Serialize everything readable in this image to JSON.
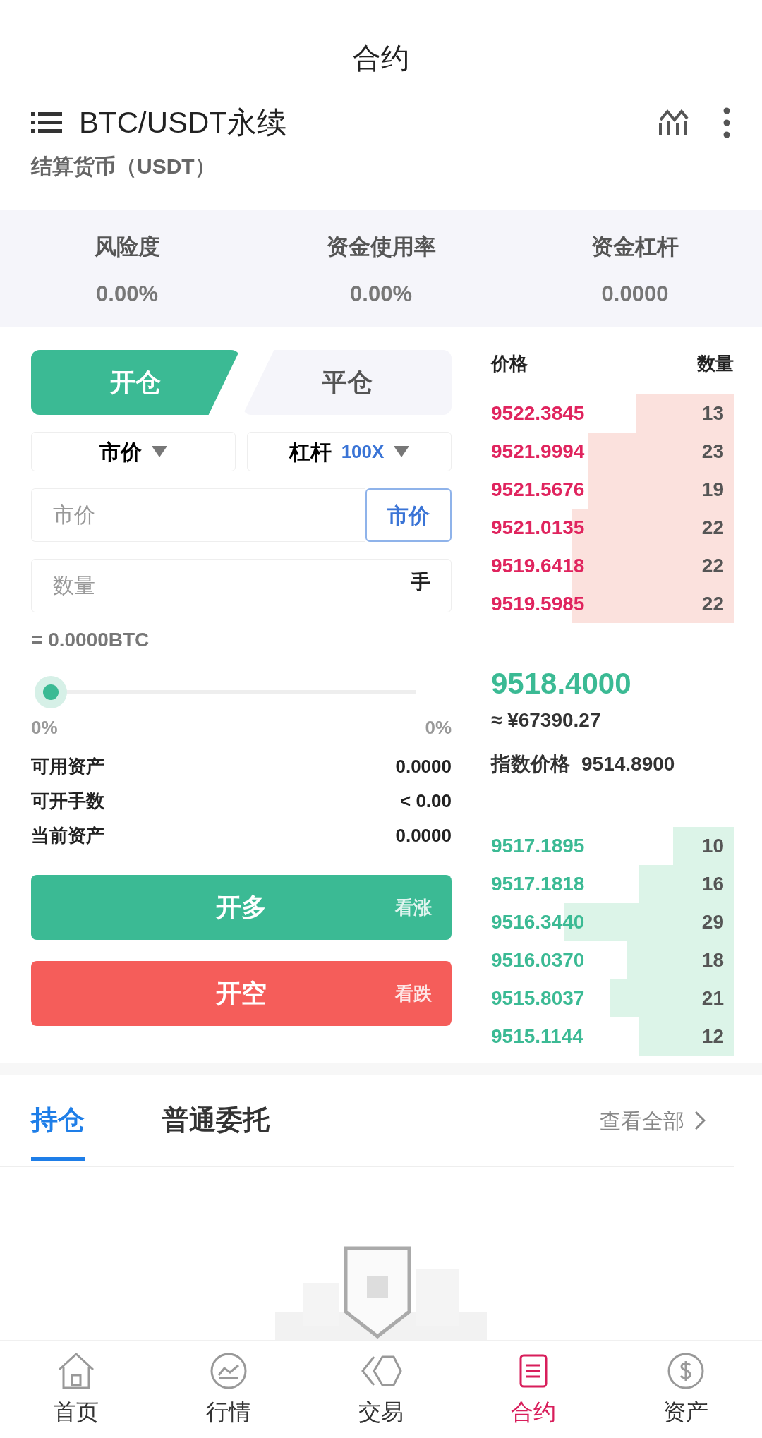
{
  "title": "合约",
  "pair": {
    "name": "BTC/USDT永续",
    "settlement": "结算货币（USDT）"
  },
  "stats": [
    {
      "label": "风险度",
      "value": "0.00%"
    },
    {
      "label": "资金使用率",
      "value": "0.00%"
    },
    {
      "label": "资金杠杆",
      "value": "0.0000"
    }
  ],
  "mode_tabs": [
    {
      "label": "开仓",
      "selected": true
    },
    {
      "label": "平仓",
      "selected": false
    }
  ],
  "order_type": {
    "label": "市价"
  },
  "leverage": {
    "label": "杠杆",
    "value": "100X"
  },
  "price_field": {
    "placeholder": "市价",
    "button": "市价"
  },
  "amount_field": {
    "placeholder": "数量",
    "unit": "手"
  },
  "equivalent": "= 0.0000BTC",
  "slider": {
    "level": 0,
    "min_label": "0%",
    "max_label": "0%"
  },
  "info": [
    {
      "label": "可用资产",
      "value": "0.0000"
    },
    {
      "label": "可开手数",
      "value": "< 0.00"
    },
    {
      "label": "当前资产",
      "value": "0.0000"
    }
  ],
  "actions": [
    {
      "kind": "long",
      "label": "开多",
      "hint": "看涨"
    },
    {
      "kind": "short",
      "label": "开空",
      "hint": "看跌"
    }
  ],
  "book": {
    "columns": [
      "价格",
      "数量"
    ],
    "asks": [
      {
        "price": "9522.3845",
        "amount": "13",
        "level": 0.4
      },
      {
        "price": "9521.9994",
        "amount": "23",
        "level": 0.6
      },
      {
        "price": "9521.5676",
        "amount": "19",
        "level": 0.6
      },
      {
        "price": "9521.0135",
        "amount": "22",
        "level": 0.67
      },
      {
        "price": "9519.6418",
        "amount": "22",
        "level": 0.67
      },
      {
        "price": "9519.5985",
        "amount": "22",
        "level": 0.67
      }
    ],
    "last_price": "9518.4000",
    "cny": "≈ ¥67390.27",
    "index_label": "指数价格",
    "index_value": "9514.8900",
    "bids": [
      {
        "price": "9517.1895",
        "amount": "10",
        "level": 0.25
      },
      {
        "price": "9517.1818",
        "amount": "16",
        "level": 0.39
      },
      {
        "price": "9516.3440",
        "amount": "29",
        "level": 0.7
      },
      {
        "price": "9516.0370",
        "amount": "18",
        "level": 0.44
      },
      {
        "price": "9515.8037",
        "amount": "21",
        "level": 0.51
      },
      {
        "price": "9515.1144",
        "amount": "12",
        "level": 0.39
      }
    ]
  },
  "position_tabs": [
    {
      "label": "持仓",
      "selected": true
    },
    {
      "label": "普通委托",
      "selected": false
    }
  ],
  "view_all": "查看全部",
  "bottom_nav": [
    {
      "label": "首页",
      "selected": false
    },
    {
      "label": "行情",
      "selected": false
    },
    {
      "label": "交易",
      "selected": false
    },
    {
      "label": "合约",
      "selected": true
    },
    {
      "label": "资产",
      "selected": false
    }
  ]
}
